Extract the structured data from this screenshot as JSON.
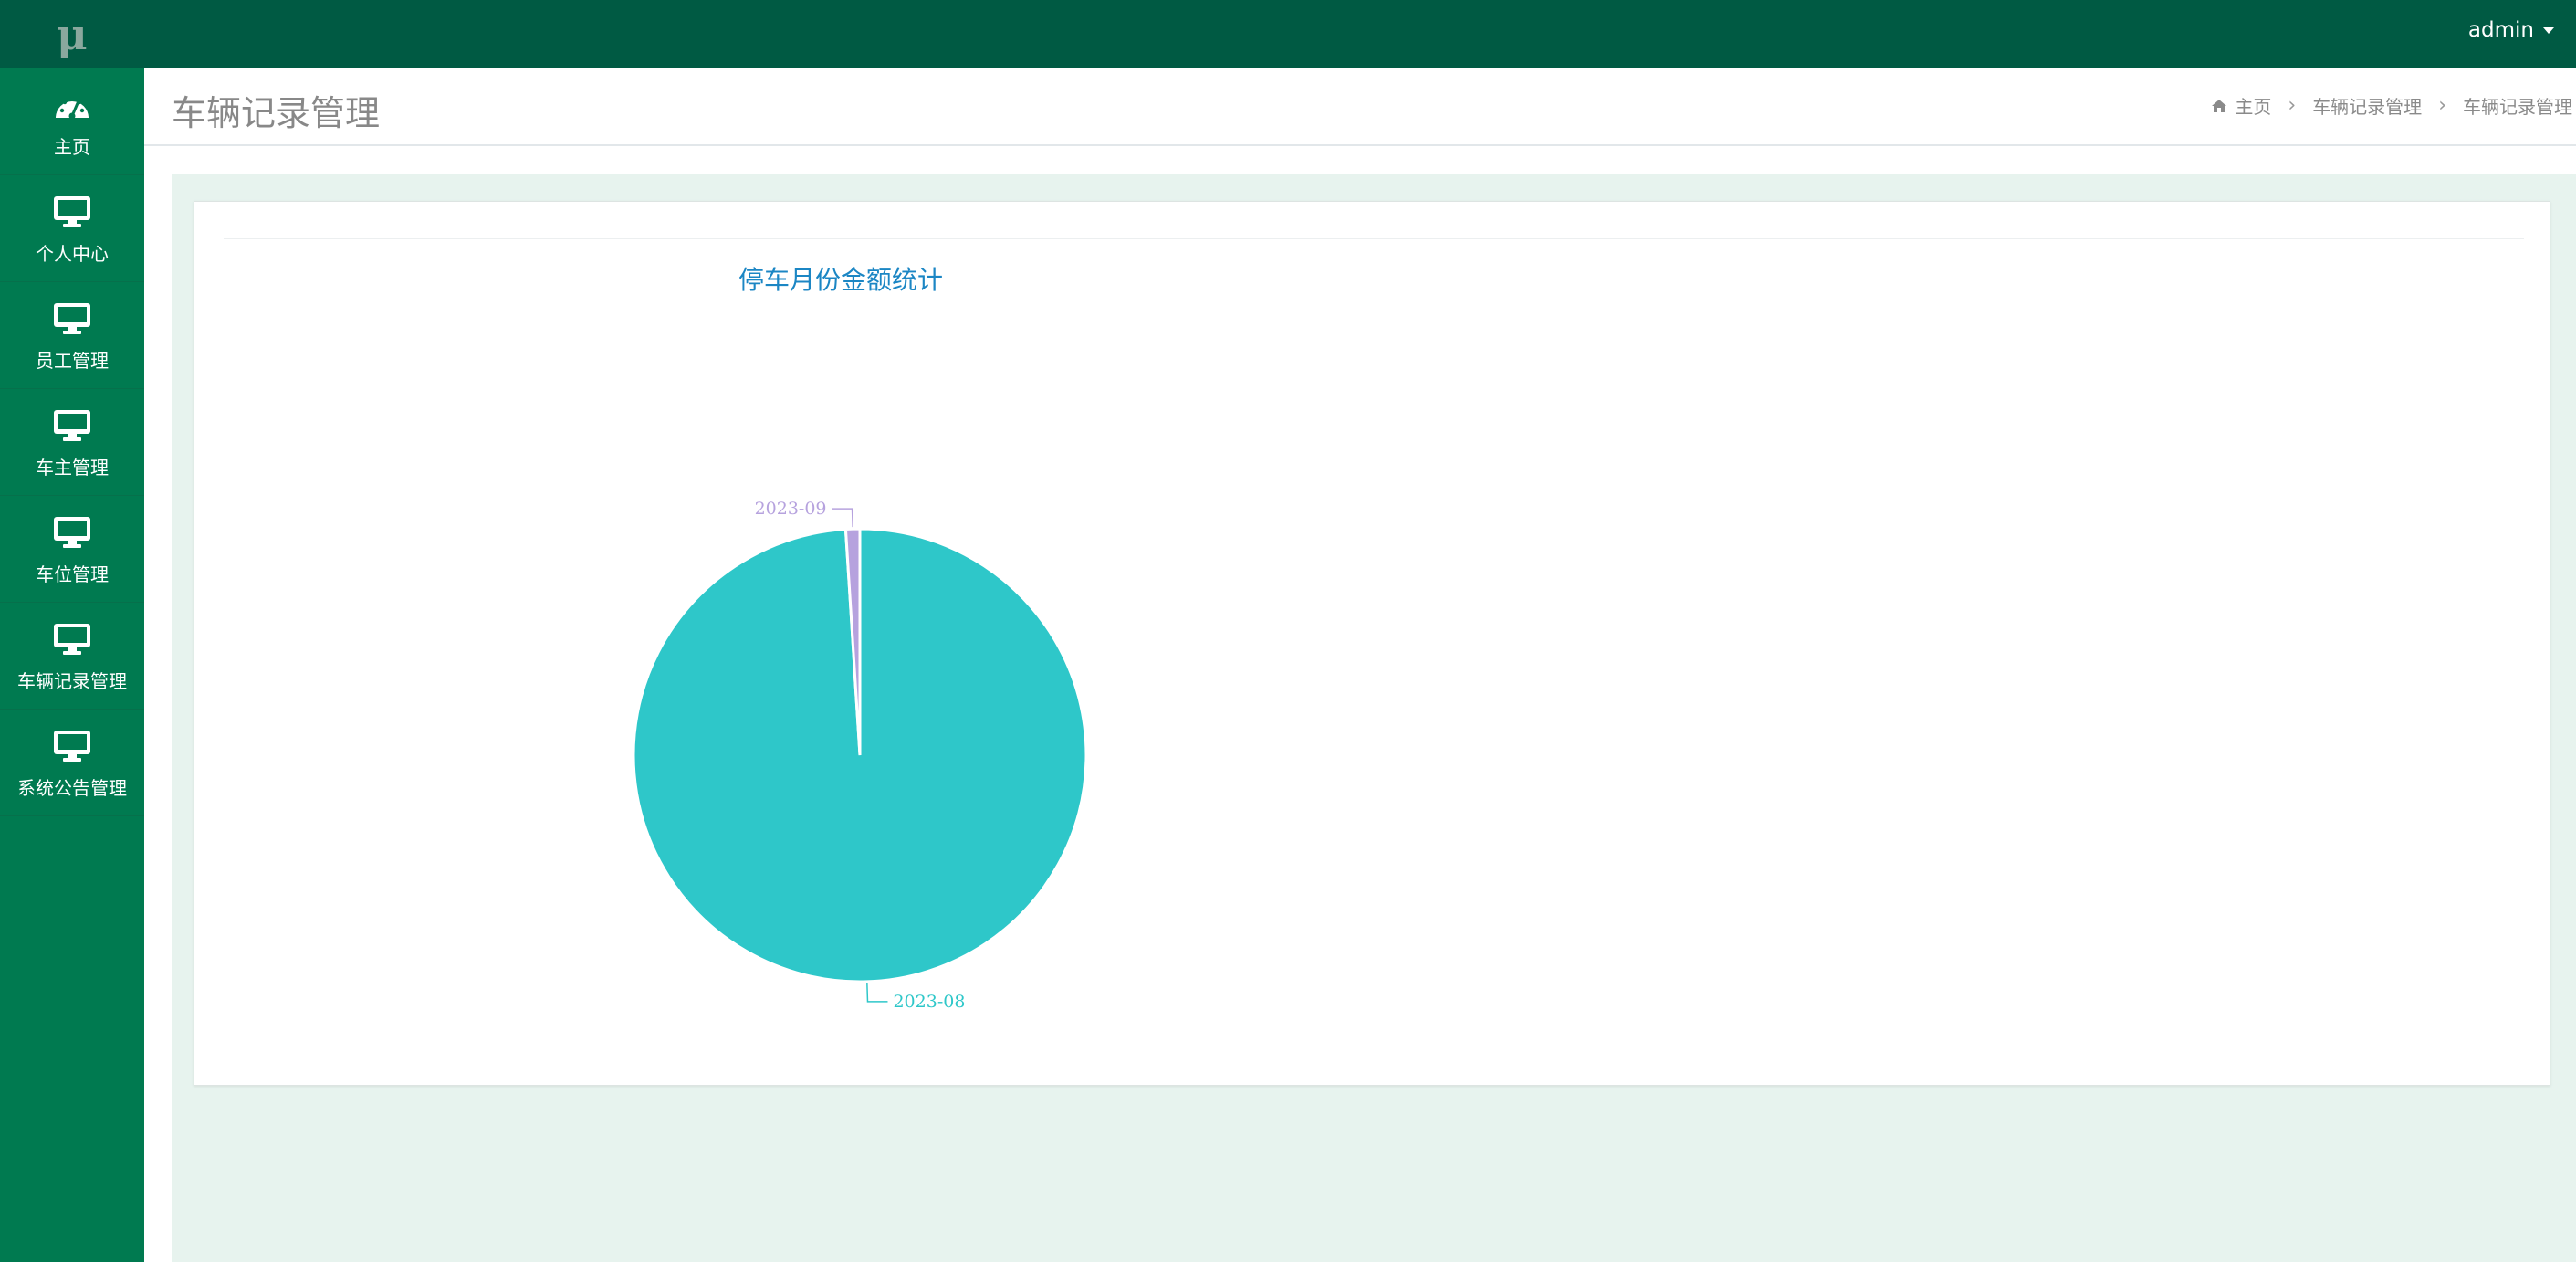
{
  "app": {
    "logo": "μ",
    "user": "admin"
  },
  "sidebar": {
    "items": [
      {
        "label": "主页",
        "icon": "dashboard-icon"
      },
      {
        "label": "个人中心",
        "icon": "monitor-icon"
      },
      {
        "label": "员工管理",
        "icon": "monitor-icon"
      },
      {
        "label": "车主管理",
        "icon": "monitor-icon"
      },
      {
        "label": "车位管理",
        "icon": "monitor-icon"
      },
      {
        "label": "车辆记录管理",
        "icon": "monitor-icon"
      },
      {
        "label": "系统公告管理",
        "icon": "monitor-icon"
      }
    ]
  },
  "header": {
    "title": "车辆记录管理",
    "breadcrumb": [
      "主页",
      "车辆记录管理",
      "车辆记录管理"
    ]
  },
  "colors": {
    "topbar": "#005a43",
    "sidebar": "#007a50",
    "content_bg": "#e7f3ee",
    "title_blue": "#1b86c4",
    "slice_teal": "#2ec7c9",
    "slice_purple": "#b6a2de"
  },
  "chart_data": {
    "type": "pie",
    "title": "停车月份金额统计",
    "categories": [
      "2023-08",
      "2023-09"
    ],
    "values": [
      99,
      1
    ],
    "colors": [
      "#2ec7c9",
      "#b6a2de"
    ]
  }
}
